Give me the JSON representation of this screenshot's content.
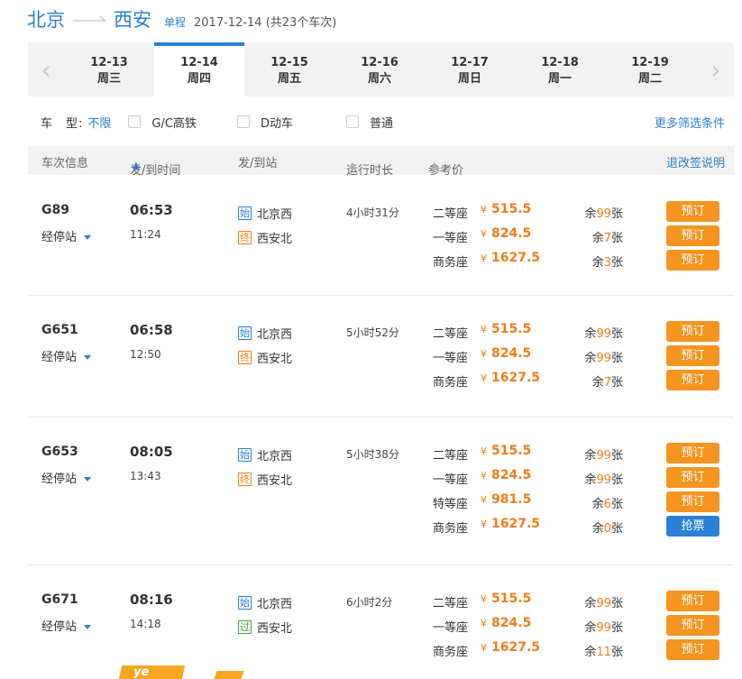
{
  "header": {
    "from": "北京",
    "to": "西安",
    "trip_type": "单程",
    "date_summary": "2017-12-14 (共23个车次)"
  },
  "dates": [
    {
      "date": "12-13",
      "weekday": "周三"
    },
    {
      "date": "12-14",
      "weekday": "周四",
      "active": true
    },
    {
      "date": "12-15",
      "weekday": "周五"
    },
    {
      "date": "12-16",
      "weekday": "周六"
    },
    {
      "date": "12-17",
      "weekday": "周日"
    },
    {
      "date": "12-18",
      "weekday": "周一"
    },
    {
      "date": "12-19",
      "weekday": "周二"
    }
  ],
  "filters": {
    "label": "车　型:",
    "any": "不限",
    "options": [
      "G/C高铁",
      "D动车",
      "普通"
    ],
    "more": "更多筛选条件"
  },
  "table_header": {
    "train": "车次信息",
    "time": "发/到时间",
    "station": "发/到站",
    "duration": "运行时长",
    "price": "参考价",
    "rule": "退改签说明"
  },
  "stops_label": "经停站",
  "trains": [
    {
      "number": "G89",
      "depart": "06:53",
      "arrive": "11:24",
      "from_tag": "始",
      "from": "北京西",
      "to_tag": "终",
      "to": "西安北",
      "duration": "4小时31分",
      "seats": [
        {
          "class": "二等座",
          "price": "515.5",
          "left_prefix": "余",
          "left_num": "99",
          "left_suffix": "张",
          "button": "预订",
          "grab": false
        },
        {
          "class": "一等座",
          "price": "824.5",
          "left_prefix": "余",
          "left_num": "7",
          "left_suffix": "张",
          "button": "预订",
          "grab": false
        },
        {
          "class": "商务座",
          "price": "1627.5",
          "left_prefix": "余",
          "left_num": "3",
          "left_suffix": "张",
          "button": "预订",
          "grab": false
        }
      ]
    },
    {
      "number": "G651",
      "depart": "06:58",
      "arrive": "12:50",
      "from_tag": "始",
      "from": "北京西",
      "to_tag": "终",
      "to": "西安北",
      "duration": "5小时52分",
      "seats": [
        {
          "class": "二等座",
          "price": "515.5",
          "left_prefix": "余",
          "left_num": "99",
          "left_suffix": "张",
          "button": "预订",
          "grab": false
        },
        {
          "class": "一等座",
          "price": "824.5",
          "left_prefix": "余",
          "left_num": "99",
          "left_suffix": "张",
          "button": "预订",
          "grab": false
        },
        {
          "class": "商务座",
          "price": "1627.5",
          "left_prefix": "余",
          "left_num": "7",
          "left_suffix": "张",
          "button": "预订",
          "grab": false
        }
      ]
    },
    {
      "number": "G653",
      "depart": "08:05",
      "arrive": "13:43",
      "from_tag": "始",
      "from": "北京西",
      "to_tag": "终",
      "to": "西安北",
      "duration": "5小时38分",
      "seats": [
        {
          "class": "二等座",
          "price": "515.5",
          "left_prefix": "余",
          "left_num": "99",
          "left_suffix": "张",
          "button": "预订",
          "grab": false
        },
        {
          "class": "一等座",
          "price": "824.5",
          "left_prefix": "余",
          "left_num": "99",
          "left_suffix": "张",
          "button": "预订",
          "grab": false
        },
        {
          "class": "特等座",
          "price": "981.5",
          "left_prefix": "余",
          "left_num": "6",
          "left_suffix": "张",
          "button": "预订",
          "grab": false
        },
        {
          "class": "商务座",
          "price": "1627.5",
          "left_prefix": "余",
          "left_num": "0",
          "left_suffix": "张",
          "button": "抢票",
          "grab": true
        }
      ]
    },
    {
      "number": "G671",
      "depart": "08:16",
      "arrive": "14:18",
      "from_tag": "始",
      "from": "北京西",
      "to_tag": "过",
      "to": "西安北",
      "duration": "6小时2分",
      "seats": [
        {
          "class": "二等座",
          "price": "515.5",
          "left_prefix": "余",
          "left_num": "99",
          "left_suffix": "张",
          "button": "预订",
          "grab": false
        },
        {
          "class": "一等座",
          "price": "824.5",
          "left_prefix": "余",
          "left_num": "99",
          "left_suffix": "张",
          "button": "预订",
          "grab": false
        },
        {
          "class": "商务座",
          "price": "1627.5",
          "left_prefix": "余",
          "left_num": "11",
          "left_suffix": "张",
          "button": "预订",
          "grab": false
        }
      ]
    }
  ],
  "promo_text": "ye",
  "colors": {
    "accent": "#2b7fd6",
    "price": "#f07c1a",
    "button": "#f5941f"
  },
  "icons": {
    "prev": "chevron-left-icon",
    "next": "chevron-right-icon",
    "sort": "sort-arrow-icon",
    "stops": "caret-down-icon"
  }
}
